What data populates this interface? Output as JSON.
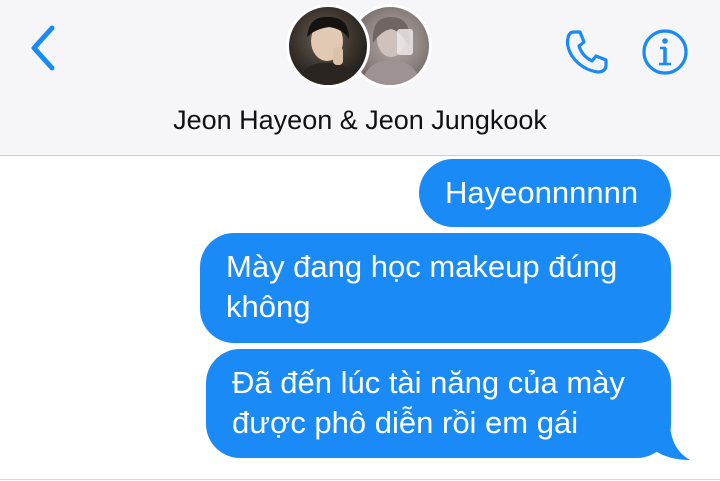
{
  "header": {
    "title": "Jeon Hayeon & Jeon Jungkook",
    "back_icon": "chevron-left-icon",
    "call_icon": "phone-icon",
    "info_icon": "info-icon",
    "accent_color": "#1a8bf6"
  },
  "messages": [
    {
      "text": "Hayeonnnnnn",
      "direction": "outgoing"
    },
    {
      "text": "Mày đang học makeup đúng không",
      "direction": "outgoing"
    },
    {
      "text": "Đã đến lúc tài năng của mày được phô diễn rồi em gái",
      "direction": "outgoing"
    }
  ],
  "colors": {
    "bubble": "#1a8bf6",
    "header_bg": "#f6f6f8",
    "icon": "#1a8bf6"
  }
}
